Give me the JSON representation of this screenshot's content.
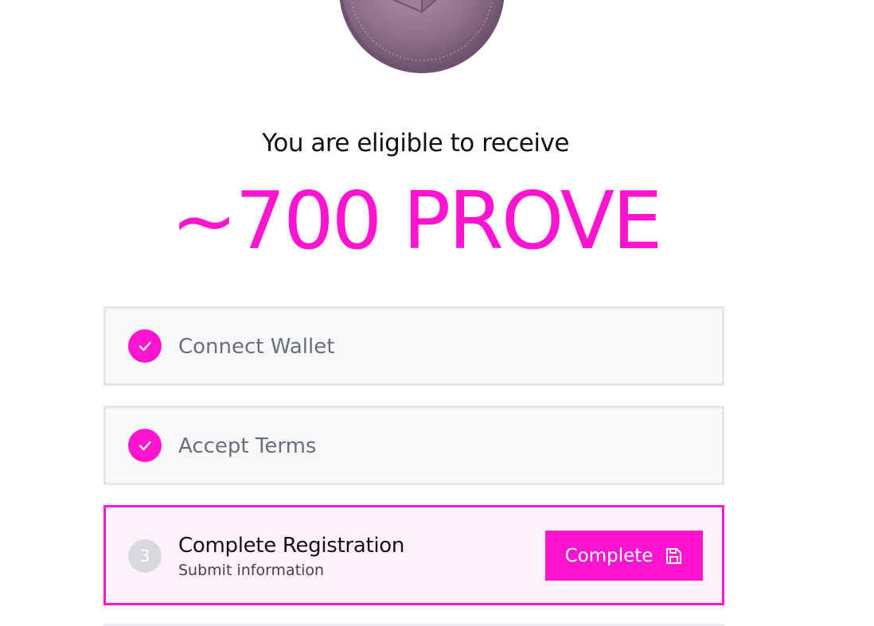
{
  "eligibility": {
    "heading": "You are eligible to receive",
    "amount": "~700 PROVE"
  },
  "steps": [
    {
      "label": "Connect Wallet",
      "status": "done",
      "icon": "check-icon"
    },
    {
      "label": "Accept Terms",
      "status": "done",
      "icon": "check-icon"
    },
    {
      "number": "3",
      "title": "Complete Registration",
      "subtitle": "Submit information",
      "status": "active",
      "button_label": "Complete",
      "button_icon": "save-icon"
    }
  ],
  "colors": {
    "accent": "#ff14cf",
    "step_done_bg": "#f7f8fa",
    "step_active_bg": "#fff1fb",
    "step_border": "#e4e6ea"
  }
}
